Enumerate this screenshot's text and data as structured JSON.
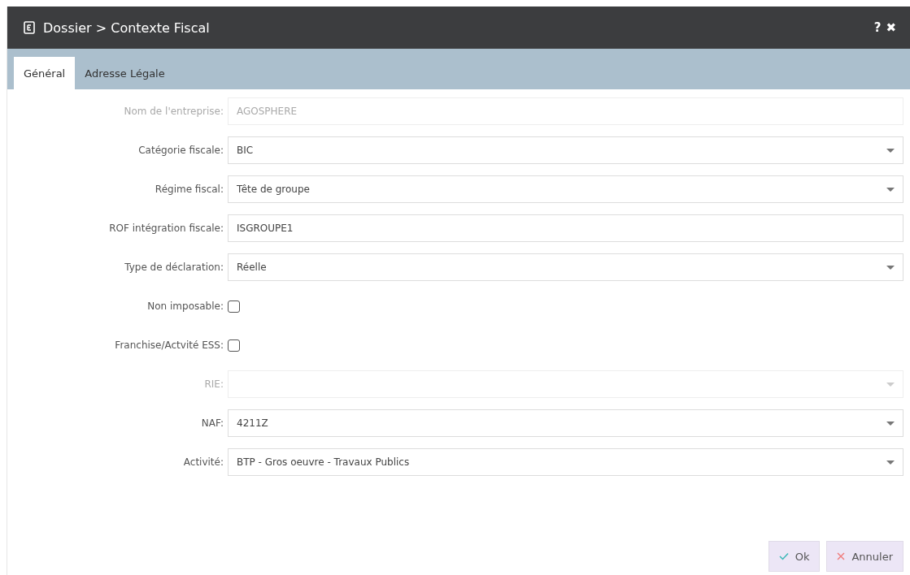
{
  "window": {
    "title": "Dossier > Contexte Fiscal",
    "help": "?",
    "close": "✖"
  },
  "tabs": [
    {
      "label": "Général",
      "selected": true
    },
    {
      "label": "Adresse Légale",
      "selected": false
    }
  ],
  "fields": [
    {
      "kind": "text",
      "label": "Nom de l'entreprise:",
      "value": "AGOSPHERE",
      "disabled": true
    },
    {
      "kind": "select",
      "label": "Catégorie fiscale:",
      "value": "BIC",
      "disabled": false
    },
    {
      "kind": "select",
      "label": "Régime fiscal:",
      "value": "Tête de groupe",
      "disabled": false
    },
    {
      "kind": "text",
      "label": "ROF intégration fiscale:",
      "value": "ISGROUPE1",
      "disabled": false
    },
    {
      "kind": "select",
      "label": "Type de déclaration:",
      "value": "Réelle",
      "disabled": false
    },
    {
      "kind": "checkbox",
      "label": "Non imposable:",
      "checked": false
    },
    {
      "kind": "checkbox",
      "label": "Franchise/Actvité ESS:",
      "checked": false
    },
    {
      "kind": "select",
      "label": "RIE:",
      "disabled": true
    },
    {
      "kind": "select",
      "label": "NAF:",
      "value": "4211Z",
      "disabled": false
    },
    {
      "kind": "select",
      "label": "Activité:",
      "value": "BTP - Gros oeuvre - Travaux Publics",
      "disabled": false
    }
  ],
  "buttons": [
    {
      "kind": "ok",
      "label": "Ok"
    },
    {
      "kind": "cancel",
      "label": "Annuler"
    }
  ]
}
